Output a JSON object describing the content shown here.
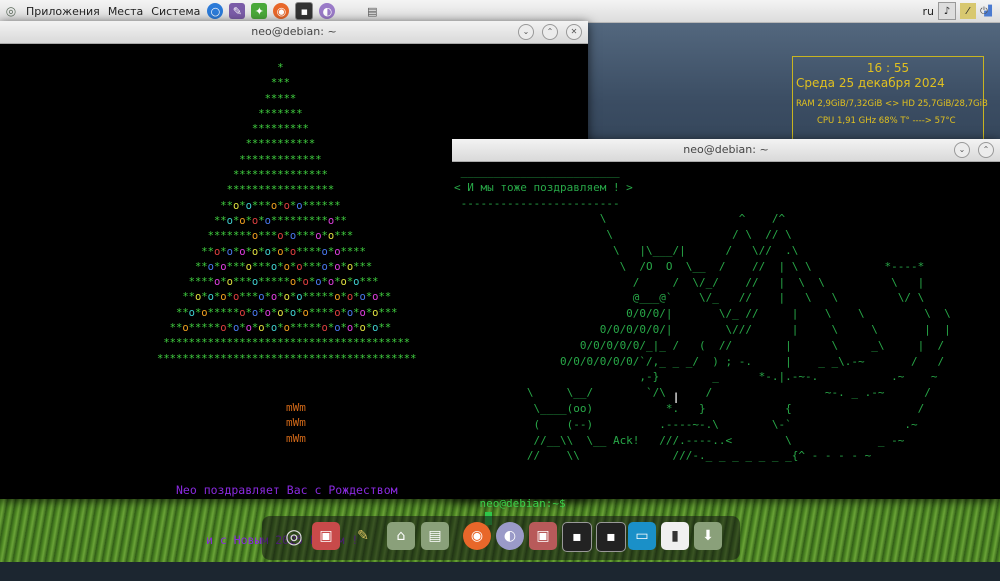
{
  "panel": {
    "menus": [
      "Приложения",
      "Места",
      "Система"
    ],
    "layout": "ru"
  },
  "conky": {
    "time": "16 : 55",
    "date": "Среда 25 декабря 2024",
    "mem": "RAM 2,9GiB/7,32GiB <> HD 25,7GiB/28,7GiB",
    "cpu": "CPU 1,91 GHz 68%  T°  ---->        57°C"
  },
  "window_left": {
    "title": "neo@debian: ~",
    "tree_lines": [
      "                   *",
      "                  ***",
      "                 *****",
      "                *******",
      "               *********",
      "              ***********",
      "             *************",
      "            ***************",
      "           *****************",
      "          **o*o***o*o*o******",
      "         **o*o*o*o*********o**",
      "        *******o***o*o***o*o***",
      "       **o*o*o*o*o*o*o****o*o****",
      "      **o*o***o***o*o*o***o*o*o***",
      "     ****o*o***o*****o*o*o*o*o*o***",
      "    **o*o*o*o***o*o*o*o*****o*o*o*o**",
      "   **o*o*****o*o*o*o*o*o****o*o*o*o***",
      "  **o*****o*o*o*o*o*o*****o*o*o*o*o**",
      " ***************************************",
      "*****************************************"
    ],
    "trunk": [
      "mWm",
      "mWm",
      "mWm"
    ],
    "greeting": [
      "Neo поздравляет Вас с Рождеством",
      "и с Новым 2025 Годом !"
    ]
  },
  "window_right": {
    "title": "neo@debian: ~",
    "cowsay": [
      " ________________________",
      "< И мы тоже поздравляем ! >",
      " ------------------------",
      "                      \\                    ^    /^",
      "                       \\                  / \\  // \\",
      "                        \\   |\\___/|      /   \\//  .\\",
      "                         \\  /O  O  \\__  /    //  | \\ \\           *----*",
      "                           /     /  \\/_/    //   |  \\  \\          \\   |",
      "                           @___@`    \\/_   //    |   \\   \\         \\/ \\",
      "                          0/0/0/|       \\/_ //     |    \\    \\         \\  \\",
      "                      0/0/0/0/0/|        \\///      |     \\     \\       |  |",
      "                   0/0/0/0/0/_|_ /   (  //        |      \\     _\\     |  /",
      "                0/0/0/0/0/0/`/,_ _ _/  ) ; -.     |    _ _\\.-~       /   /",
      "                            ,-}        _      *-.|.-~-.           .~    ~",
      "           \\     \\__/        `/\\      /                 ~-. _ .-~      /",
      "            \\____(oo)           *.   }            {                   /",
      "            (    (--)          .----~-.\\        \\-`                 .~",
      "            //__\\\\  \\__ Ack!   ///.----..<        \\             _ -~",
      "           //    \\\\              ///-._ _ _ _ _ _ _{^ - - - - ~"
    ],
    "prompt": "neo@debian:~$"
  }
}
